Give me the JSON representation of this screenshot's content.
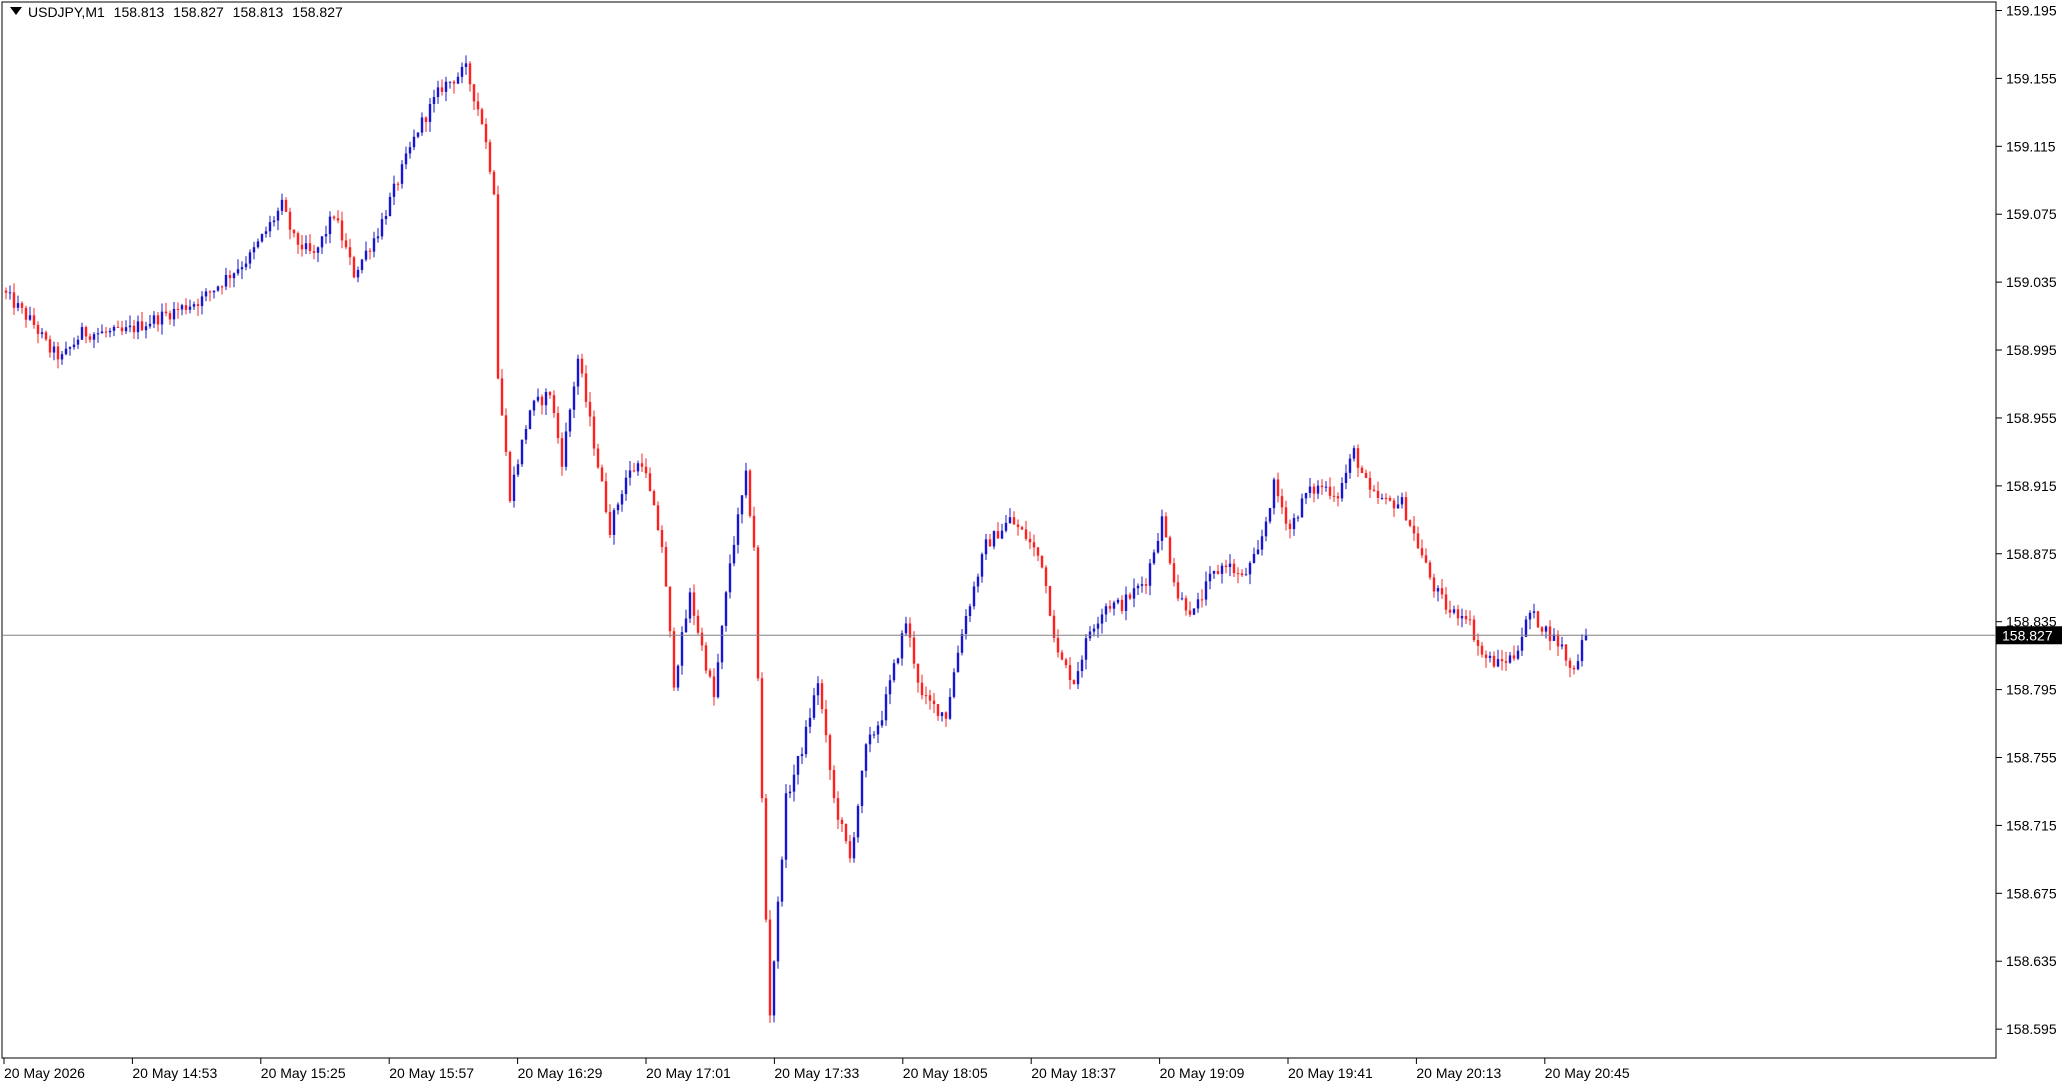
{
  "header": {
    "symbol": "USDJPY,M1",
    "open": "158.813",
    "high": "158.827",
    "low": "158.813",
    "close": "158.827"
  },
  "colors": {
    "bull": "#1616d0",
    "bear": "#ff2020",
    "grid": "#000000",
    "background": "#ffffff",
    "price_line": "#808080",
    "price_label_bg": "#000000"
  },
  "chart_data": {
    "type": "candlestick",
    "symbol": "USDJPY",
    "timeframe": "M1",
    "ylim": [
      158.578,
      159.2
    ],
    "y_ticks": [
      "159.195",
      "159.155",
      "159.115",
      "159.075",
      "159.035",
      "158.995",
      "158.955",
      "158.915",
      "158.875",
      "158.835",
      "158.795",
      "158.755",
      "158.715",
      "158.675",
      "158.635",
      "158.595"
    ],
    "x_ticks": [
      "20 May 2026",
      "20 May 14:53",
      "20 May 15:25",
      "20 May 15:57",
      "20 May 16:29",
      "20 May 17:01",
      "20 May 17:33",
      "20 May 18:05",
      "20 May 18:37",
      "20 May 19:09",
      "20 May 19:41",
      "20 May 20:13",
      "20 May 20:45"
    ],
    "current_price": "158.827",
    "grid": false,
    "series": [
      {
        "keypoints": [
          [
            0,
            159.03
          ],
          [
            8,
            159.01
          ],
          [
            12,
            158.995
          ],
          [
            15,
            158.99
          ],
          [
            20,
            159.005
          ],
          [
            30,
            159.005
          ],
          [
            40,
            159.015
          ],
          [
            50,
            159.025
          ],
          [
            62,
            159.05
          ],
          [
            70,
            159.08
          ],
          [
            73,
            159.06
          ],
          [
            78,
            159.05
          ],
          [
            83,
            159.075
          ],
          [
            88,
            159.04
          ],
          [
            94,
            159.065
          ],
          [
            99,
            159.095
          ],
          [
            104,
            159.125
          ],
          [
            110,
            159.15
          ],
          [
            116,
            159.16
          ],
          [
            120,
            159.13
          ],
          [
            123,
            159.09
          ],
          [
            124,
            158.98
          ],
          [
            127,
            158.91
          ],
          [
            132,
            158.96
          ],
          [
            137,
            158.97
          ],
          [
            140,
            158.93
          ],
          [
            144,
            158.99
          ],
          [
            148,
            158.94
          ],
          [
            152,
            158.89
          ],
          [
            156,
            158.92
          ],
          [
            160,
            158.93
          ],
          [
            165,
            158.88
          ],
          [
            168,
            158.8
          ],
          [
            172,
            158.85
          ],
          [
            178,
            158.79
          ],
          [
            182,
            158.87
          ],
          [
            186,
            158.92
          ],
          [
            188,
            158.88
          ],
          [
            189,
            158.8
          ],
          [
            191,
            158.66
          ],
          [
            192,
            158.605
          ],
          [
            196,
            158.73
          ],
          [
            200,
            158.76
          ],
          [
            204,
            158.8
          ],
          [
            208,
            158.73
          ],
          [
            212,
            158.695
          ],
          [
            216,
            158.76
          ],
          [
            220,
            158.78
          ],
          [
            226,
            158.835
          ],
          [
            230,
            158.79
          ],
          [
            236,
            158.78
          ],
          [
            240,
            158.83
          ],
          [
            246,
            158.88
          ],
          [
            252,
            158.895
          ],
          [
            256,
            158.885
          ],
          [
            260,
            158.87
          ],
          [
            264,
            158.815
          ],
          [
            268,
            158.8
          ],
          [
            272,
            158.83
          ],
          [
            276,
            158.845
          ],
          [
            280,
            158.845
          ],
          [
            286,
            158.86
          ],
          [
            290,
            158.895
          ],
          [
            294,
            158.85
          ],
          [
            298,
            158.84
          ],
          [
            302,
            158.86
          ],
          [
            306,
            158.87
          ],
          [
            310,
            158.86
          ],
          [
            314,
            158.875
          ],
          [
            318,
            158.915
          ],
          [
            322,
            158.89
          ],
          [
            326,
            158.91
          ],
          [
            330,
            158.915
          ],
          [
            334,
            158.91
          ],
          [
            338,
            158.935
          ],
          [
            342,
            158.91
          ],
          [
            346,
            158.905
          ],
          [
            350,
            158.905
          ],
          [
            354,
            158.88
          ],
          [
            358,
            158.855
          ],
          [
            362,
            158.84
          ],
          [
            366,
            158.84
          ],
          [
            370,
            158.815
          ],
          [
            374,
            158.81
          ],
          [
            378,
            158.815
          ],
          [
            382,
            158.84
          ],
          [
            386,
            158.83
          ],
          [
            390,
            158.82
          ],
          [
            392,
            158.807
          ],
          [
            394,
            158.812
          ],
          [
            395,
            158.827
          ]
        ]
      }
    ]
  }
}
